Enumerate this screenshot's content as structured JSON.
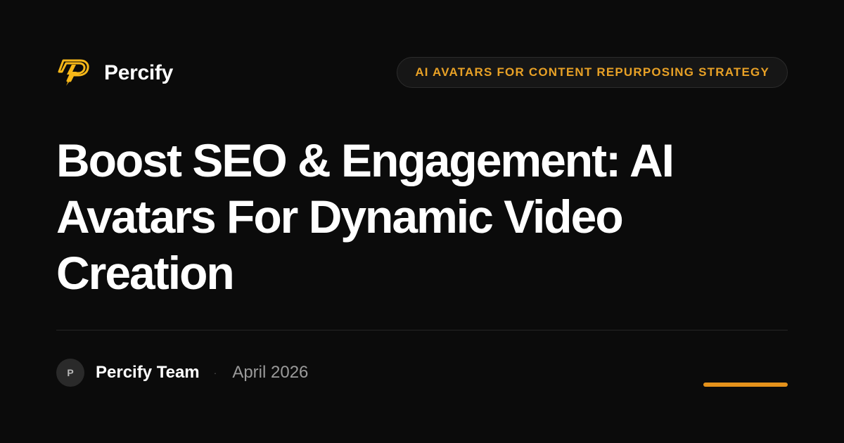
{
  "brand": {
    "name": "Percify",
    "logo_icon": "lightning-p-logo-icon",
    "logo_color": "#f7b718"
  },
  "category": {
    "label": "AI AVATARS FOR CONTENT REPURPOSING STRATEGY",
    "color": "#e8a126"
  },
  "headline": {
    "text": "Boost SEO & Engagement: AI Avatars For Dynamic Video Creation"
  },
  "meta": {
    "author_initial": "P",
    "author_name": "Percify Team",
    "separator": "·",
    "date": "April 2026"
  },
  "colors": {
    "background": "#0b0b0b",
    "accent": "#e5921b",
    "text_primary": "#ffffff",
    "text_muted": "#9a9a9a"
  }
}
